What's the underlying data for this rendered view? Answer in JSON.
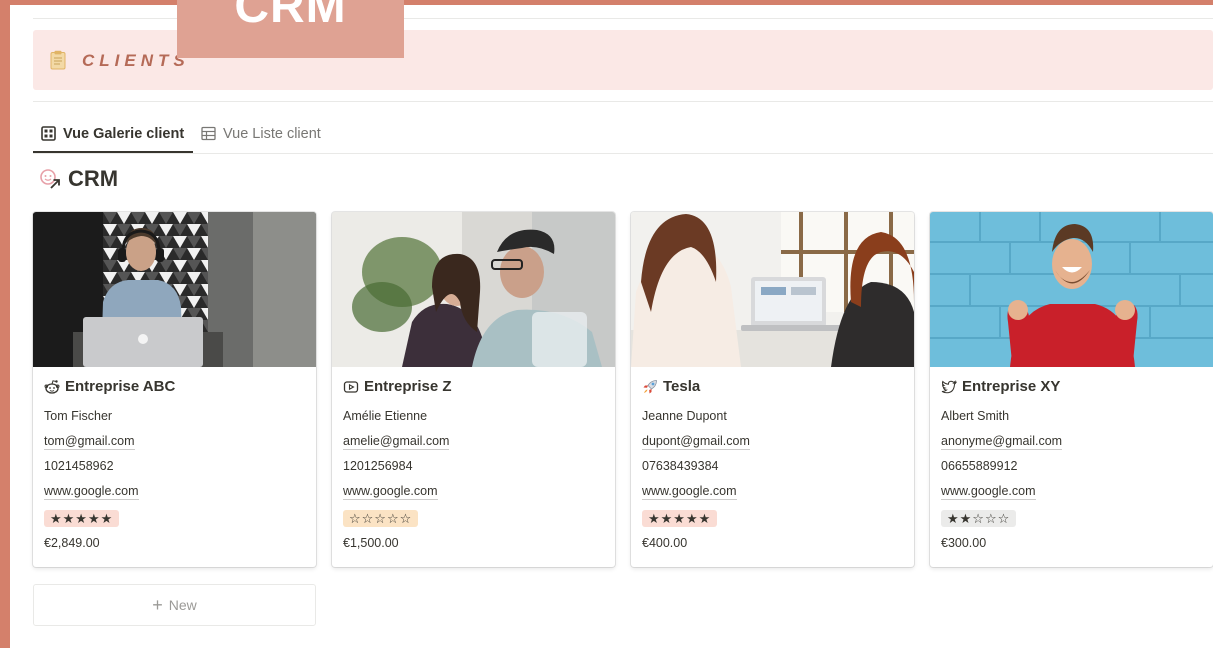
{
  "banner": {
    "text": "CRM"
  },
  "callout": {
    "icon": "clipboard-icon",
    "text": "CLIENTS"
  },
  "tabs": [
    {
      "label": "Vue Galerie client",
      "icon": "gallery-icon",
      "active": true
    },
    {
      "label": "Vue Liste client",
      "icon": "table-icon",
      "active": false
    }
  ],
  "database": {
    "title": "CRM",
    "icon": "crm-icon"
  },
  "cards": [
    {
      "title": "Entreprise ABC",
      "icon": "reddit-icon",
      "contact": "Tom Fischer",
      "email": "tom@gmail.com",
      "phone": "1021458962",
      "website": "www.google.com",
      "rating": "★★★★★",
      "rating_value": 5,
      "rating_bg": "#fadcd4",
      "amount": "€2,849.00",
      "photo": "man-with-headphones-laptop"
    },
    {
      "title": "Entreprise Z",
      "icon": "youtube-icon",
      "contact": "Amélie Etienne",
      "email": "amelie@gmail.com",
      "phone": "1201256984",
      "website": "www.google.com",
      "rating": "☆☆☆☆☆",
      "rating_value": 0,
      "rating_bg": "#fbe3c4",
      "amount": "€1,500.00",
      "photo": "two-people-meeting"
    },
    {
      "title": "Tesla",
      "icon": "rocket-icon",
      "contact": "Jeanne Dupont",
      "email": "dupont@gmail.com",
      "phone": "07638439384",
      "website": "www.google.com",
      "rating": "★★★★★",
      "rating_value": 5,
      "rating_bg": "#fadcd4",
      "amount": "€400.00",
      "photo": "women-at-laptop"
    },
    {
      "title": "Entreprise XY",
      "icon": "twitter-icon",
      "contact": "Albert Smith",
      "email": "anonyme@gmail.com",
      "phone": "06655889912",
      "website": "www.google.com",
      "rating": "★★☆☆☆",
      "rating_value": 2,
      "rating_bg": "#ebebea",
      "amount": "€300.00",
      "photo": "happy-man-red-sweater"
    }
  ],
  "new_button": {
    "label": "New"
  },
  "colors": {
    "accent": "#d4806b",
    "callout_bg": "#fbe8e6",
    "banner_bg": "#dfa293"
  }
}
